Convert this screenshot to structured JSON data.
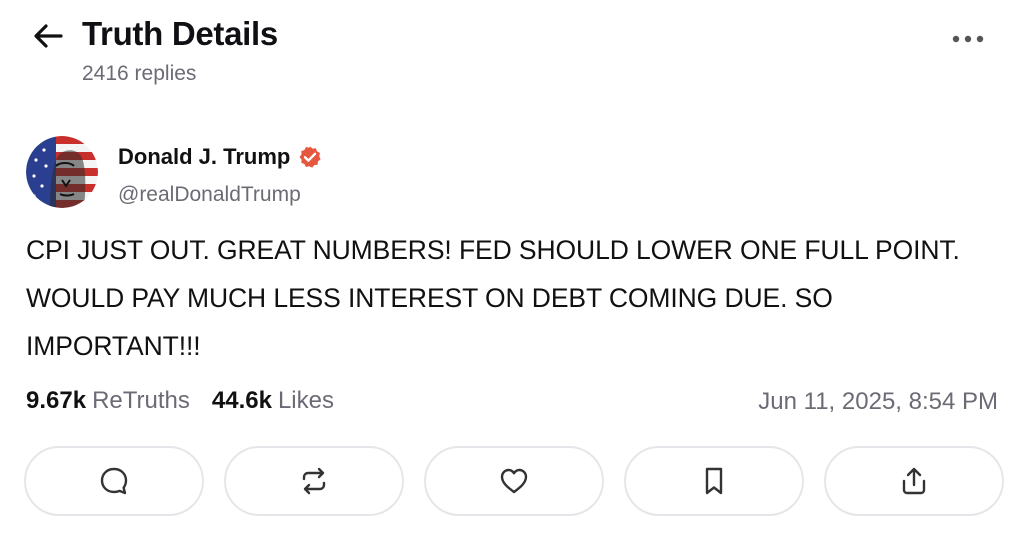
{
  "header": {
    "back_icon": "arrow-left-icon",
    "title": "Truth Details",
    "reply_count": "2416 replies",
    "more_icon": "more-horizontal-icon"
  },
  "post": {
    "author": {
      "name": "Donald J. Trump",
      "handle": "@realDonaldTrump",
      "verified": true,
      "verified_color": "#e5573f",
      "avatar": "avatar-portrait-flag"
    },
    "text": "CPI JUST OUT. GREAT NUMBERS! FED SHOULD LOWER ONE FULL POINT. WOULD PAY MUCH LESS INTEREST ON DEBT COMING DUE. SO IMPORTANT!!!",
    "stats": {
      "retruths_count": "9.67k",
      "retruths_label": "ReTruths",
      "likes_count": "44.6k",
      "likes_label": "Likes"
    },
    "timestamp": "Jun 11, 2025, 8:54 PM"
  },
  "actions": [
    {
      "name": "reply",
      "icon": "comment-icon"
    },
    {
      "name": "retruth",
      "icon": "repost-icon"
    },
    {
      "name": "like",
      "icon": "heart-icon"
    },
    {
      "name": "bookmark",
      "icon": "bookmark-icon"
    },
    {
      "name": "share",
      "icon": "share-icon"
    }
  ],
  "colors": {
    "text_primary": "#111111",
    "text_secondary": "#6b6b76",
    "border": "#e6e6ea",
    "verified": "#e5573f"
  }
}
